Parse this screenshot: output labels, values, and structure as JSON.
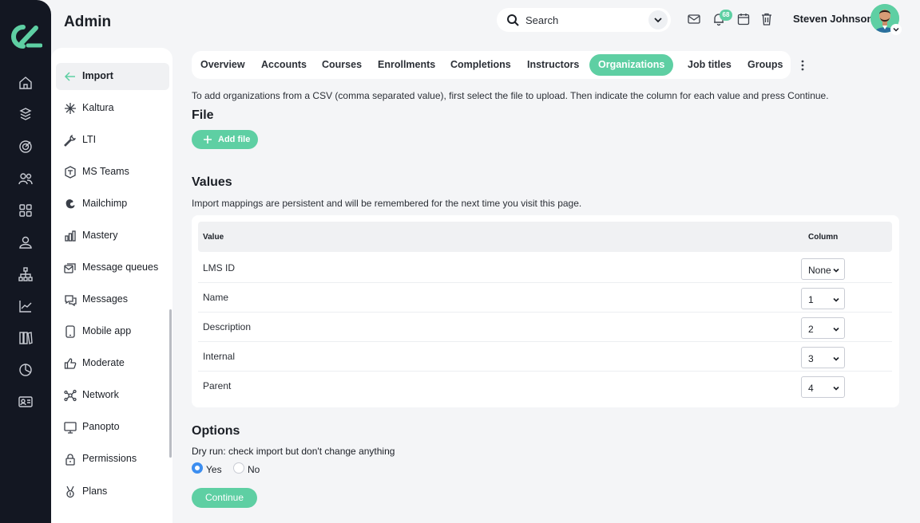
{
  "header": {
    "title": "Admin",
    "search_text": "Search",
    "notifications_count": "68",
    "user_name": "Steven Johnson"
  },
  "rail": {
    "icons": [
      "home-icon",
      "courses-icon",
      "target-icon",
      "users-icon",
      "apps-icon",
      "person-icon",
      "org-chart-icon",
      "analytics-icon",
      "library-icon",
      "reports-icon",
      "id-card-icon"
    ]
  },
  "sidebar": {
    "items": [
      {
        "label": "Import",
        "icon": "arrow-left-icon",
        "active": true
      },
      {
        "label": "Kaltura",
        "icon": "sparkle-icon"
      },
      {
        "label": "LTI",
        "icon": "wrench-icon"
      },
      {
        "label": "MS Teams",
        "icon": "teams-icon"
      },
      {
        "label": "Mailchimp",
        "icon": "mailchimp-icon"
      },
      {
        "label": "Mastery",
        "icon": "bar-chart-icon"
      },
      {
        "label": "Message queues",
        "icon": "message-queue-icon"
      },
      {
        "label": "Messages",
        "icon": "chat-icon"
      },
      {
        "label": "Mobile app",
        "icon": "mobile-icon"
      },
      {
        "label": "Moderate",
        "icon": "thumbs-up-icon"
      },
      {
        "label": "Network",
        "icon": "network-icon"
      },
      {
        "label": "Panopto",
        "icon": "monitor-icon"
      },
      {
        "label": "Permissions",
        "icon": "lock-icon"
      },
      {
        "label": "Plans",
        "icon": "medal-icon"
      }
    ]
  },
  "tabs": [
    {
      "label": "Overview"
    },
    {
      "label": "Accounts"
    },
    {
      "label": "Courses"
    },
    {
      "label": "Enrollments"
    },
    {
      "label": "Completions"
    },
    {
      "label": "Instructors"
    },
    {
      "label": "Organizations",
      "active": true
    },
    {
      "label": "Job titles"
    },
    {
      "label": "Groups"
    }
  ],
  "main": {
    "intro": "To add organizations from a CSV (comma separated value), first select the file to upload. Then indicate the column for each value and press Continue.",
    "file_heading": "File",
    "add_file_label": "Add file",
    "values_heading": "Values",
    "values_note": "Import mappings are persistent and will be remembered for the next time you visit this page.",
    "table": {
      "col_value": "Value",
      "col_column": "Column",
      "rows": [
        {
          "value": "LMS ID",
          "column": "None"
        },
        {
          "value": "Name",
          "column": "1"
        },
        {
          "value": "Description",
          "column": "2"
        },
        {
          "value": "Internal",
          "column": "3"
        },
        {
          "value": "Parent",
          "column": "4"
        }
      ]
    },
    "options_heading": "Options",
    "dry_run_label": "Dry run: check import but don't change anything",
    "yes_label": "Yes",
    "no_label": "No",
    "continue_label": "Continue"
  },
  "colors": {
    "accent": "#5ecfa3",
    "rail": "#131722",
    "radio": "#3d8ef0"
  }
}
